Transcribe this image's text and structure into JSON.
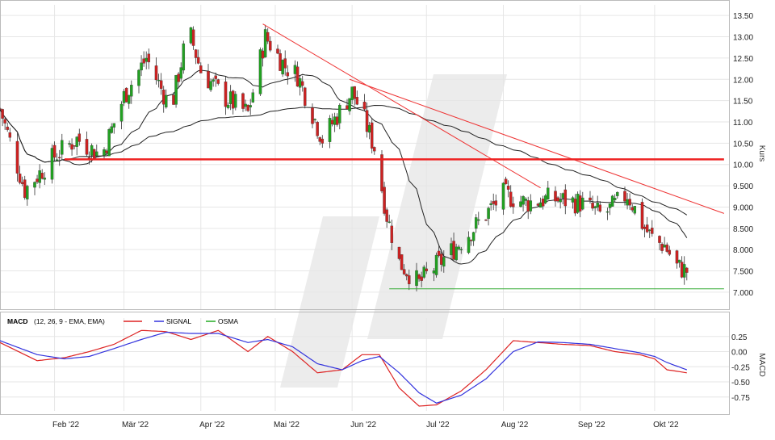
{
  "chart_data": [
    {
      "type": "candlestick",
      "ylabel": "Kurs",
      "ylim": [
        6.6,
        13.75
      ],
      "yticks": [
        7.0,
        7.5,
        8.0,
        8.5,
        9.0,
        9.5,
        10.0,
        10.5,
        11.0,
        11.5,
        12.0,
        12.5,
        13.0,
        13.5
      ],
      "ytick_labels": [
        "7.000",
        "7.500",
        "8.000",
        "8.500",
        "9.000",
        "9.500",
        "10.00",
        "10.50",
        "11.00",
        "11.50",
        "12.00",
        "12.50",
        "13.00",
        "13.50"
      ],
      "x_tick_labels": [
        "Feb '22",
        "Mär '22",
        "Apr '22",
        "Mai '22",
        "Jun '22",
        "Jul '22",
        "Aug '22",
        "Sep '22",
        "Okt '22"
      ],
      "x_tick_dates": [
        "2022-02-01",
        "2022-03-01",
        "2022-04-01",
        "2022-05-01",
        "2022-06-01",
        "2022-07-01",
        "2022-08-01",
        "2022-09-01",
        "2022-10-01"
      ],
      "x_range": [
        "2022-01-10",
        "2022-10-31"
      ],
      "grid": true,
      "series": [
        {
          "kind": "close",
          "x": [
            "2022-01-10",
            "2022-01-20",
            "2022-02-01",
            "2022-02-10",
            "2022-02-20",
            "2022-03-01",
            "2022-03-10",
            "2022-03-20",
            "2022-03-27",
            "2022-04-01",
            "2022-04-10",
            "2022-04-20",
            "2022-04-27",
            "2022-05-05",
            "2022-05-10",
            "2022-05-20",
            "2022-06-01",
            "2022-06-05",
            "2022-06-10",
            "2022-06-15",
            "2022-06-20",
            "2022-06-28",
            "2022-07-01",
            "2022-07-10",
            "2022-07-20",
            "2022-08-01",
            "2022-08-10",
            "2022-08-20",
            "2022-09-01",
            "2022-09-10",
            "2022-09-20",
            "2022-09-27",
            "2022-10-01",
            "2022-10-05",
            "2022-10-10",
            "2022-10-14"
          ],
          "y": [
            11.3,
            9.4,
            10.2,
            10.6,
            10.2,
            11.6,
            12.5,
            11.3,
            13.2,
            12.2,
            11.6,
            11.2,
            13.0,
            12.3,
            12.1,
            10.6,
            11.7,
            11.2,
            10.4,
            8.8,
            7.7,
            7.2,
            7.4,
            7.9,
            8.5,
            9.3,
            9.1,
            9.2,
            9.1,
            8.8,
            9.3,
            8.5,
            8.2,
            8.1,
            7.6,
            7.5
          ]
        },
        {
          "kind": "moving_average_short",
          "color": "#222222"
        },
        {
          "kind": "moving_average_long",
          "color": "#222222"
        }
      ],
      "annotations": [
        {
          "type": "trendline",
          "from": [
            "2022-04-26",
            13.3
          ],
          "to": [
            "2022-08-16",
            9.45
          ]
        },
        {
          "type": "trendline",
          "from": [
            "2022-05-31",
            12.0
          ],
          "to": [
            "2022-10-29",
            8.85
          ]
        },
        {
          "type": "horizontal_line",
          "y": 10.12,
          "from": "2022-02-05",
          "to": "2022-10-29"
        },
        {
          "type": "horizontal_line",
          "y": 7.08,
          "from": "2022-06-16",
          "to": "2022-10-29"
        }
      ]
    },
    {
      "type": "line",
      "ylabel": "MACD",
      "ylim": [
        -0.98,
        0.42
      ],
      "yticks": [
        0.25,
        0.0,
        -0.25,
        -0.5,
        -0.75
      ],
      "ytick_labels": [
        "0.25",
        "0.00",
        "-0.25",
        "-0.50",
        "-0.75"
      ],
      "grid": true,
      "legend": {
        "title": "MACD",
        "params": "(12, 26, 9 - EMA, EMA)",
        "entries": [
          {
            "name": "SIGNAL",
            "color": "#3333dd"
          },
          {
            "name": "OSMA",
            "color": "#22aa22"
          }
        ],
        "placement": "top-left"
      },
      "series": [
        {
          "color": "#dd2222",
          "x": [
            "2022-01-10",
            "2022-01-25",
            "2022-02-05",
            "2022-02-15",
            "2022-02-25",
            "2022-03-08",
            "2022-03-18",
            "2022-03-28",
            "2022-04-08",
            "2022-04-20",
            "2022-04-28",
            "2022-05-08",
            "2022-05-18",
            "2022-05-28",
            "2022-06-05",
            "2022-06-12",
            "2022-06-20",
            "2022-06-28",
            "2022-07-05",
            "2022-07-15",
            "2022-07-25",
            "2022-08-05",
            "2022-08-15",
            "2022-08-25",
            "2022-09-05",
            "2022-09-15",
            "2022-09-25",
            "2022-10-01",
            "2022-10-06",
            "2022-10-14"
          ],
          "y": [
            0.15,
            -0.15,
            -0.1,
            0.0,
            0.12,
            0.35,
            0.33,
            0.2,
            0.35,
            0.0,
            0.25,
            0.0,
            -0.35,
            -0.3,
            -0.05,
            -0.05,
            -0.6,
            -0.9,
            -0.88,
            -0.65,
            -0.3,
            0.18,
            0.15,
            0.12,
            0.1,
            0.0,
            -0.05,
            -0.12,
            -0.3,
            -0.35
          ]
        },
        {
          "name": "SIGNAL",
          "color": "#3333dd",
          "x": [
            "2022-01-10",
            "2022-01-25",
            "2022-02-05",
            "2022-02-15",
            "2022-02-25",
            "2022-03-08",
            "2022-03-18",
            "2022-03-28",
            "2022-04-08",
            "2022-04-20",
            "2022-04-28",
            "2022-05-08",
            "2022-05-18",
            "2022-05-28",
            "2022-06-05",
            "2022-06-12",
            "2022-06-20",
            "2022-06-28",
            "2022-07-05",
            "2022-07-15",
            "2022-07-25",
            "2022-08-05",
            "2022-08-15",
            "2022-08-25",
            "2022-09-05",
            "2022-09-15",
            "2022-09-25",
            "2022-10-01",
            "2022-10-06",
            "2022-10-14"
          ],
          "y": [
            0.18,
            -0.05,
            -0.12,
            -0.08,
            0.05,
            0.2,
            0.32,
            0.3,
            0.3,
            0.15,
            0.2,
            0.08,
            -0.2,
            -0.3,
            -0.15,
            -0.08,
            -0.35,
            -0.68,
            -0.85,
            -0.72,
            -0.45,
            0.0,
            0.16,
            0.15,
            0.12,
            0.05,
            -0.02,
            -0.08,
            -0.18,
            -0.3
          ]
        }
      ]
    }
  ]
}
